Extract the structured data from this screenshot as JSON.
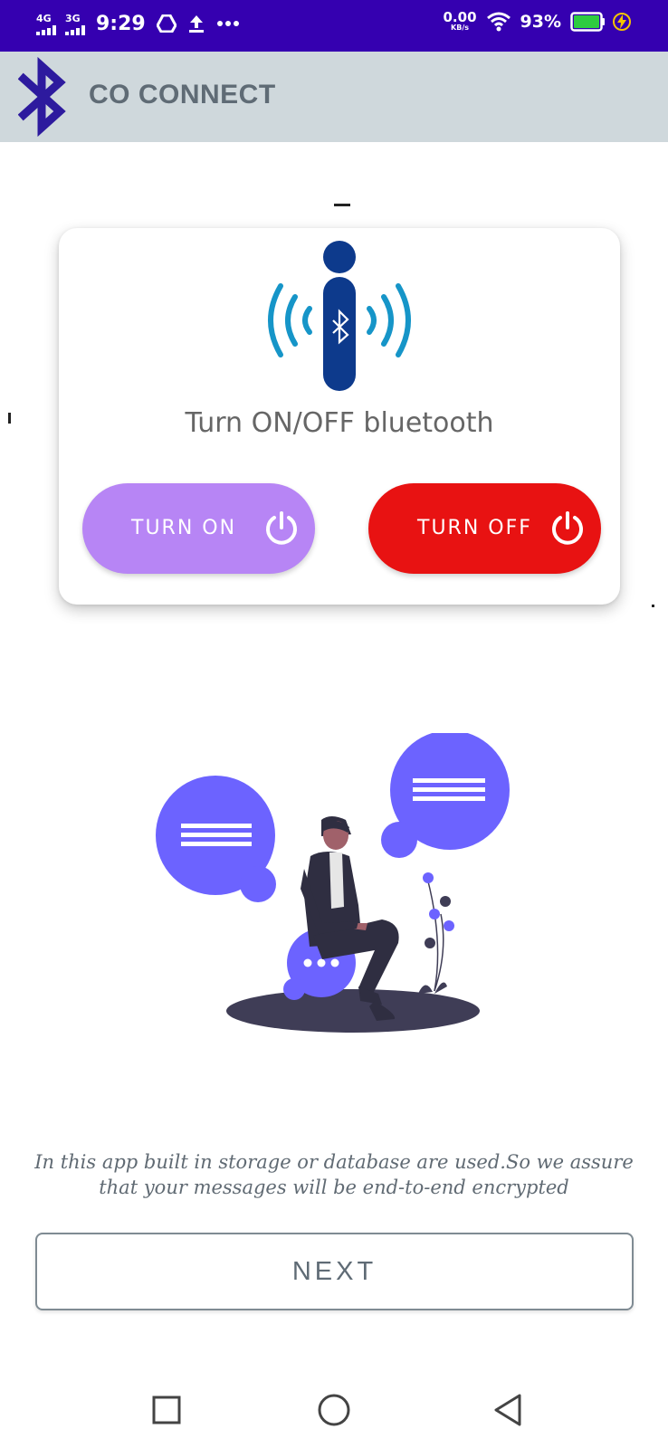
{
  "status_bar": {
    "net1": "4G",
    "net2": "3G",
    "time": "9:29",
    "speed_value": "0.00",
    "speed_unit": "KB/s",
    "battery": "93%",
    "icons": [
      "signal-4g-icon",
      "signal-3g-icon",
      "drive-icon",
      "upload-icon",
      "more-icon",
      "wifi-icon",
      "battery-icon",
      "charging-icon"
    ]
  },
  "app_bar": {
    "title": "CO CONNECT",
    "logo": "bluetooth-logo-icon"
  },
  "card": {
    "label": "Turn ON/OFF bluetooth",
    "turn_on_label": "TURN ON",
    "turn_off_label": "TURN OFF",
    "turn_on_color": "#b785f5",
    "turn_off_color": "#e81212"
  },
  "footer": {
    "note": "In this app built in storage or database are used.So we assure that your messages will be end-to-end encrypted",
    "next_label": "NEXT"
  },
  "nav": [
    "recents-icon",
    "home-icon",
    "back-icon"
  ],
  "colors": {
    "status_bar": "#3500b0",
    "app_bar": "#cfd8dc",
    "accent_purple": "#6c63ff"
  }
}
